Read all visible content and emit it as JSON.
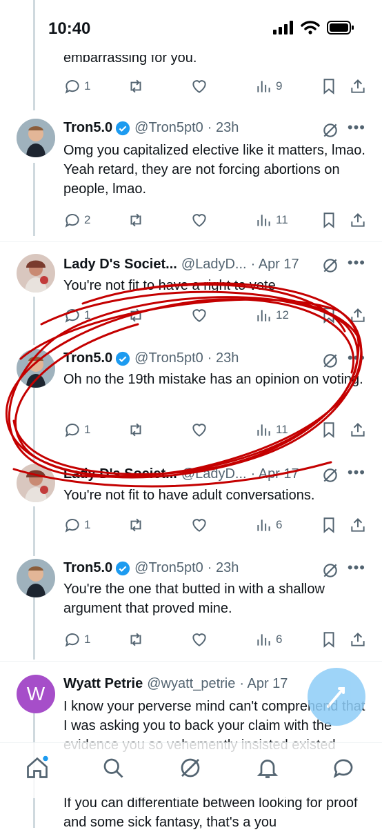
{
  "status_bar": {
    "time": "10:40"
  },
  "top_partial_text": "embarrassing for you.",
  "tweets": [
    {
      "name": "Tron5.0",
      "handle": "@Tron5pt0",
      "time": "· 23h",
      "text": "Omg you capitalized elective like it matters, lmao. Yeah retard, they are not forcing abortions on people, lmao.",
      "replies": "2",
      "views": "11"
    },
    {
      "name": "Lady D's Societ...",
      "handle": "@LadyD...",
      "time": "· Apr 17",
      "text": "You're not fit to have a right to vote",
      "replies": "1",
      "views": "12"
    },
    {
      "name": "Tron5.0",
      "handle": "@Tron5pt0",
      "time": "· 23h",
      "text": "Oh no the 19th mistake has an opinion on voting.",
      "replies": "1",
      "views": "11"
    },
    {
      "name": "Lady D's Societ...",
      "handle": "@LadyD...",
      "time": "· Apr 17",
      "text": "You're not fit to have adult conversations.",
      "replies": "1",
      "views": "6"
    },
    {
      "name": "Tron5.0",
      "handle": "@Tron5pt0",
      "time": "· 23h",
      "text": "You're the one that butted in with a shallow argument that proved mine.",
      "replies": "1",
      "views": "6"
    },
    {
      "name": "Wyatt Petrie",
      "handle": "@wyatt_petrie",
      "time": "· Apr 17",
      "text": "I know your perverse mind can't comprehend that I was asking you to back your claim with the evidence you so vehemently insisted existed",
      "text2": "If you can differentiate between looking for proof and some sick fantasy, that's a you"
    }
  ],
  "top_actions": {
    "replies": "1",
    "views": "9"
  },
  "avatar_letter": "W",
  "colors": {
    "accent": "#1d9bf0",
    "scribble": "#c40000",
    "wyatt_avatar": "#a64ec9"
  }
}
